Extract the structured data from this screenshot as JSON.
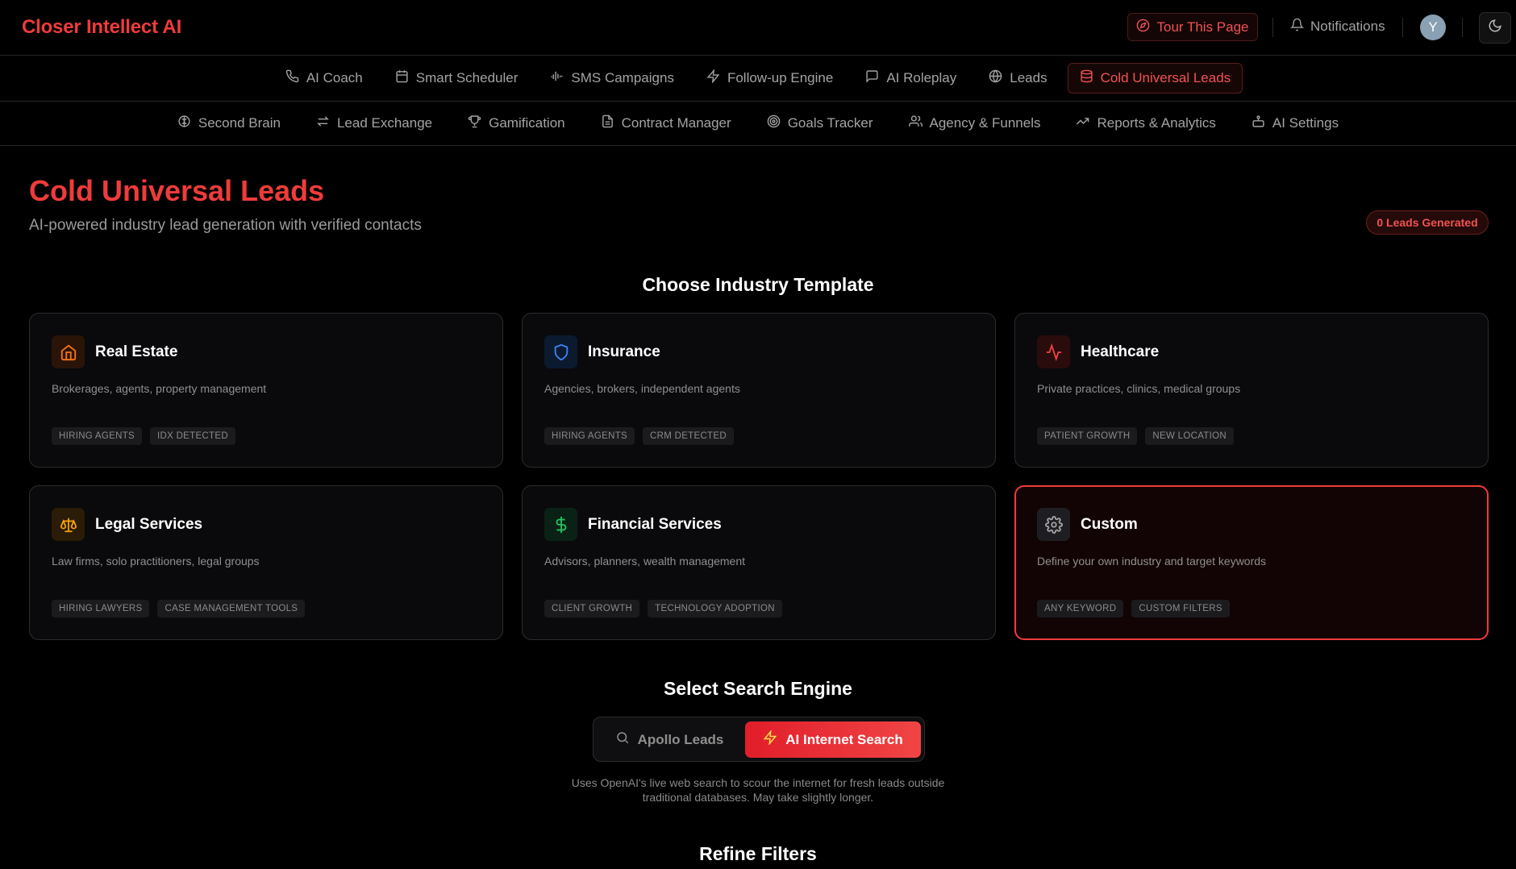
{
  "app": {
    "brand": "Closer Intellect AI"
  },
  "topbar": {
    "tour_label": "Tour This Page",
    "notifications_label": "Notifications",
    "avatar_initial": "Y"
  },
  "nav_primary": [
    {
      "label": "AI Coach",
      "icon": "phone-icon"
    },
    {
      "label": "Smart Scheduler",
      "icon": "calendar-icon"
    },
    {
      "label": "SMS Campaigns",
      "icon": "audio-wave-icon"
    },
    {
      "label": "Follow-up Engine",
      "icon": "lightning-icon"
    },
    {
      "label": "AI Roleplay",
      "icon": "chat-icon"
    },
    {
      "label": "Leads",
      "icon": "globe-icon"
    },
    {
      "label": "Cold Universal Leads",
      "icon": "database-icon",
      "active": true
    }
  ],
  "nav_secondary": [
    {
      "label": "Second Brain",
      "icon": "brain-icon"
    },
    {
      "label": "Lead Exchange",
      "icon": "swap-icon"
    },
    {
      "label": "Gamification",
      "icon": "trophy-icon"
    },
    {
      "label": "Contract Manager",
      "icon": "document-icon"
    },
    {
      "label": "Goals Tracker",
      "icon": "target-icon"
    },
    {
      "label": "Agency & Funnels",
      "icon": "users-icon"
    },
    {
      "label": "Reports & Analytics",
      "icon": "trend-icon"
    },
    {
      "label": "AI Settings",
      "icon": "robot-icon"
    }
  ],
  "header": {
    "title": "Cold Universal Leads",
    "subtitle": "AI-powered industry lead generation with verified contacts",
    "badge": "0 Leads Generated"
  },
  "templates": {
    "title": "Choose Industry Template",
    "items": [
      {
        "title": "Real Estate",
        "desc": "Brokerages, agents, property management",
        "tags": [
          "HIRING AGENTS",
          "IDX DETECTED"
        ],
        "icon": "home-icon",
        "color": "#f97316"
      },
      {
        "title": "Insurance",
        "desc": "Agencies, brokers, independent agents",
        "tags": [
          "HIRING AGENTS",
          "CRM DETECTED"
        ],
        "icon": "shield-icon",
        "color": "#3b82f6"
      },
      {
        "title": "Healthcare",
        "desc": "Private practices, clinics, medical groups",
        "tags": [
          "PATIENT GROWTH",
          "NEW LOCATION"
        ],
        "icon": "pulse-icon",
        "color": "#ef4444"
      },
      {
        "title": "Legal Services",
        "desc": "Law firms, solo practitioners, legal groups",
        "tags": [
          "HIRING LAWYERS",
          "CASE MANAGEMENT TOOLS"
        ],
        "icon": "scale-icon",
        "color": "#f59e0b"
      },
      {
        "title": "Financial Services",
        "desc": "Advisors, planners, wealth management",
        "tags": [
          "CLIENT GROWTH",
          "TECHNOLOGY ADOPTION"
        ],
        "icon": "dollar-icon",
        "color": "#22c55e"
      },
      {
        "title": "Custom",
        "desc": "Define your own industry and target keywords",
        "tags": [
          "ANY KEYWORD",
          "CUSTOM FILTERS"
        ],
        "icon": "gear-icon",
        "color": "#a3a3a3",
        "selected": true
      }
    ]
  },
  "search_engine": {
    "title": "Select Search Engine",
    "options": [
      "Apollo Leads",
      "AI Internet Search"
    ],
    "selected": "AI Internet Search",
    "note_line1": "Uses OpenAI's live web search to scour the internet for fresh leads outside",
    "note_line2": "traditional databases. May take slightly longer."
  },
  "filters": {
    "title": "Refine Filters"
  }
}
